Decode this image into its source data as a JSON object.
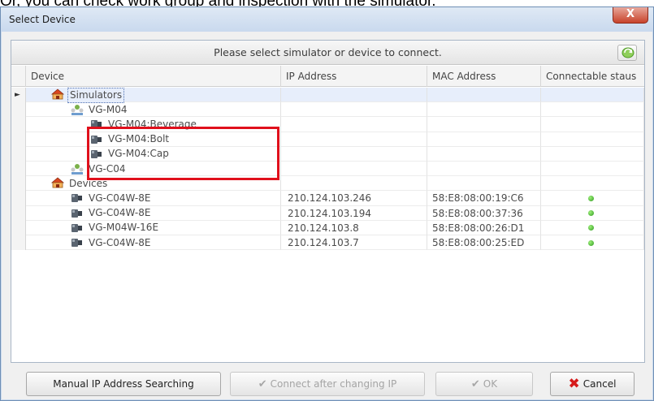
{
  "caption": "Or, you can check work group and inspection with the simulator.",
  "window": {
    "title": "Select Device",
    "close_label": "X"
  },
  "banner": "Please select simulator or device to connect.",
  "columns": [
    "Device",
    "IP Address",
    "MAC Address",
    "Connectable staus"
  ],
  "rows": [
    {
      "name": "Simulators",
      "ip": "",
      "mac": "",
      "status": false,
      "icon": "group-icon",
      "level": 0
    },
    {
      "name": "VG-M04",
      "ip": "",
      "mac": "",
      "status": false,
      "icon": "workgroup-icon",
      "level": 1
    },
    {
      "name": "VG-M04:Beverage",
      "ip": "",
      "mac": "",
      "status": false,
      "icon": "camera-icon",
      "level": 2
    },
    {
      "name": "VG-M04:Bolt",
      "ip": "",
      "mac": "",
      "status": false,
      "icon": "camera-icon",
      "level": 2
    },
    {
      "name": "VG-M04:Cap",
      "ip": "",
      "mac": "",
      "status": false,
      "icon": "camera-icon",
      "level": 2
    },
    {
      "name": "VG-C04",
      "ip": "",
      "mac": "",
      "status": false,
      "icon": "workgroup-icon",
      "level": 1
    },
    {
      "name": "Devices",
      "ip": "",
      "mac": "",
      "status": false,
      "icon": "group-icon",
      "level": 0
    },
    {
      "name": "VG-C04W-8E",
      "ip": "210.124.103.246",
      "mac": "58:E8:08:00:19:C6",
      "status": true,
      "icon": "camera-icon",
      "level": 1
    },
    {
      "name": "VG-C04W-8E",
      "ip": "210.124.103.194",
      "mac": "58:E8:08:00:37:36",
      "status": true,
      "icon": "camera-icon",
      "level": 1
    },
    {
      "name": "VG-M04W-16E",
      "ip": "210.124.103.8",
      "mac": "58:E8:08:00:26:D1",
      "status": true,
      "icon": "camera-icon",
      "level": 1
    },
    {
      "name": "VG-C04W-8E",
      "ip": "210.124.103.7",
      "mac": "58:E8:08:00:25:ED",
      "status": true,
      "icon": "camera-icon",
      "level": 1
    }
  ],
  "buttons": {
    "manual": "Manual IP Address Searching",
    "connect": "Connect after changing IP",
    "ok": "OK",
    "cancel": "Cancel"
  },
  "colors": {
    "highlight": "#e0101c",
    "status_ok": "#2e9a1f",
    "cancel_icon": "#d61a1a"
  }
}
